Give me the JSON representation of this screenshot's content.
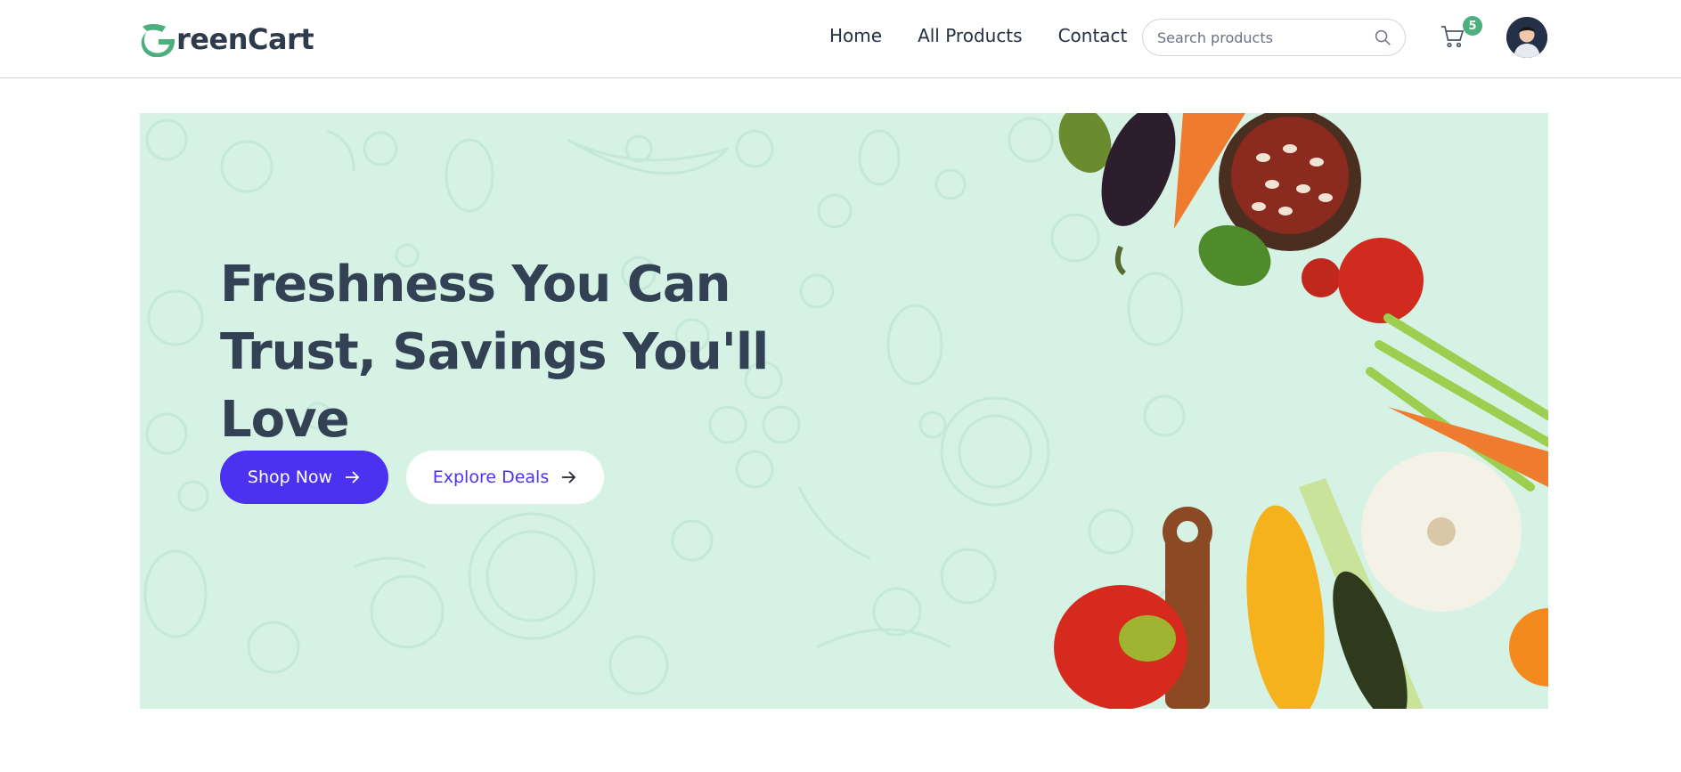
{
  "brand": {
    "name": "reenCart",
    "logo_letter": "G"
  },
  "nav": {
    "links": [
      {
        "label": "Home"
      },
      {
        "label": "All Products"
      },
      {
        "label": "Contact"
      }
    ]
  },
  "search": {
    "placeholder": "Search products",
    "icon": "search-icon"
  },
  "cart": {
    "count": "5",
    "icon": "cart-icon"
  },
  "user": {
    "icon": "avatar"
  },
  "hero": {
    "title": "Freshness You Can Trust, Savings You'll Love",
    "primary_button": "Shop Now",
    "secondary_button": "Explore Deals"
  },
  "colors": {
    "brand_green": "#4caf7d",
    "accent": "#4a32f0",
    "hero_bg": "#d5f2e5",
    "text_dark": "#334155"
  }
}
